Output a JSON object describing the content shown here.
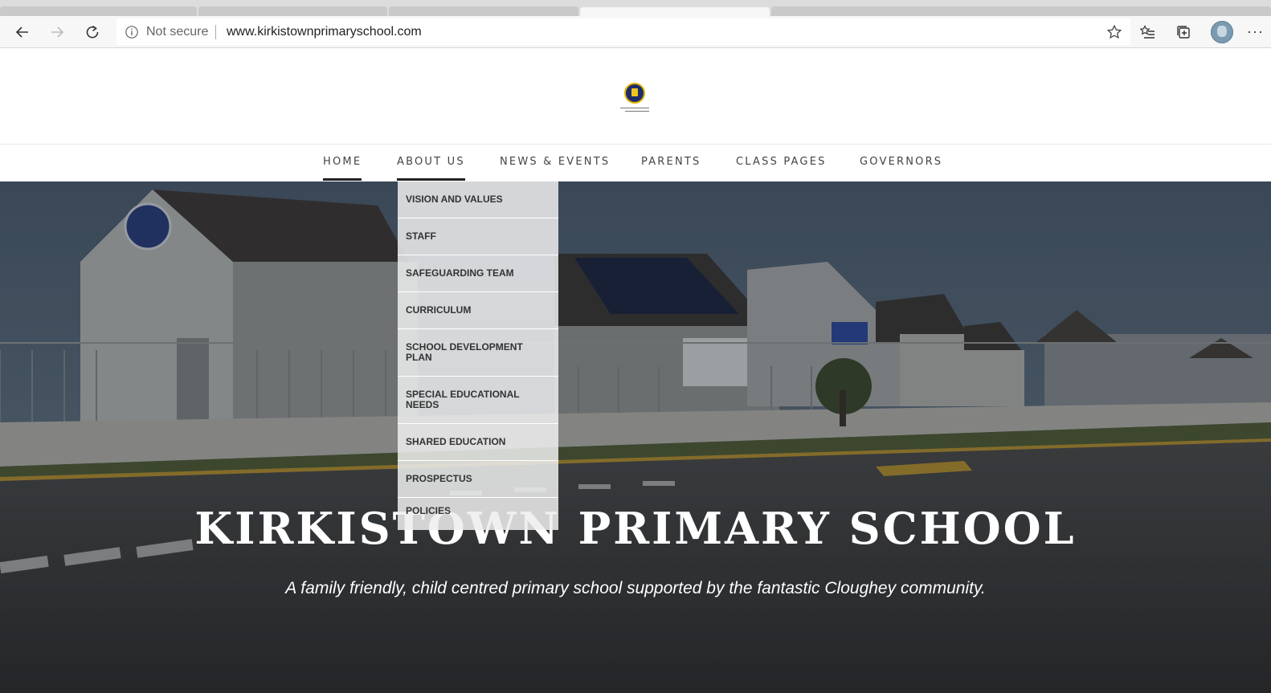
{
  "browser": {
    "address": {
      "security_label": "Not secure",
      "url": "www.kirkistownprimaryschool.com"
    },
    "icons": [
      "back-arrow-icon",
      "forward-arrow-icon",
      "refresh-icon",
      "info-icon",
      "star-icon",
      "favorites-icon",
      "collections-icon",
      "profile-avatar",
      "more-icon"
    ],
    "more_label": "···"
  },
  "nav": {
    "items": [
      {
        "label": "HOME"
      },
      {
        "label": "ABOUT US"
      },
      {
        "label": "NEWS & EVENTS"
      },
      {
        "label": "PARENTS"
      },
      {
        "label": "CLASS PAGES"
      },
      {
        "label": "GOVERNORS"
      }
    ]
  },
  "dropdown": {
    "items": [
      {
        "label": "VISION AND VALUES"
      },
      {
        "label": "STAFF"
      },
      {
        "label": "SAFEGUARDING TEAM"
      },
      {
        "label": "CURRICULUM"
      },
      {
        "label": "SCHOOL DEVELOPMENT PLAN"
      },
      {
        "label": "SPECIAL EDUCATIONAL NEEDS"
      },
      {
        "label": "SHARED EDUCATION"
      },
      {
        "label": "PROSPECTUS"
      },
      {
        "label": "POLICIES"
      }
    ]
  },
  "hero": {
    "title": "KIRKISTOWN PRIMARY SCHOOL",
    "subtitle": "A family friendly, child centred primary school supported by the fantastic Cloughey community."
  },
  "colors": {
    "accent": "#222222",
    "logo_blue": "#1d2d6b",
    "logo_gold": "#f0c419"
  }
}
